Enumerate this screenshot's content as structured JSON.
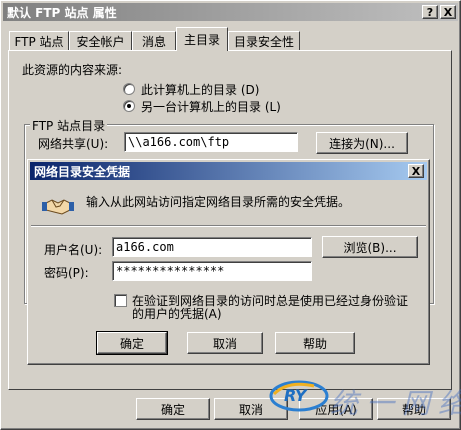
{
  "main_window": {
    "title": "默认 FTP 站点 属性",
    "help_btn": "?",
    "close_btn": "X",
    "tabs": [
      "FTP 站点",
      "安全帐户",
      "消息",
      "主目录",
      "目录安全性"
    ],
    "active_tab": "主目录",
    "content_source_label": "此资源的内容来源:",
    "radio_local": "此计算机上的目录 (D)",
    "radio_remote": "另一台计算机上的目录 (L)",
    "ftp_group_title": "FTP 站点目录",
    "share_label": "网络共享(U):",
    "share_value": "\\\\a166.com\\ftp",
    "connect_as": "连接为(N)...",
    "ok": "确定",
    "cancel": "取消",
    "apply": "应用(A)",
    "help": "帮助"
  },
  "dialog": {
    "title": "网络目录安全凭据",
    "close_btn": "X",
    "prompt": "输入从此网站访问指定网络目录所需的安全凭据。",
    "username_label": "用户名(U):",
    "username_value": "a166.com",
    "password_label": "密码(P):",
    "password_value": "***************",
    "browse": "浏览(B)...",
    "checkbox_text_1": "在验证到网络目录的访问时总是使用已经过身份验证",
    "checkbox_text_2": "的用户的凭据(A)",
    "ok": "确定",
    "cancel": "取消",
    "help": "帮助"
  },
  "watermark": {
    "text": "统一网络",
    "logo": "RY"
  },
  "colors": {
    "inactive_title": "#808080",
    "active_title_start": "#0a246a",
    "active_title_end": "#a6caf0"
  }
}
